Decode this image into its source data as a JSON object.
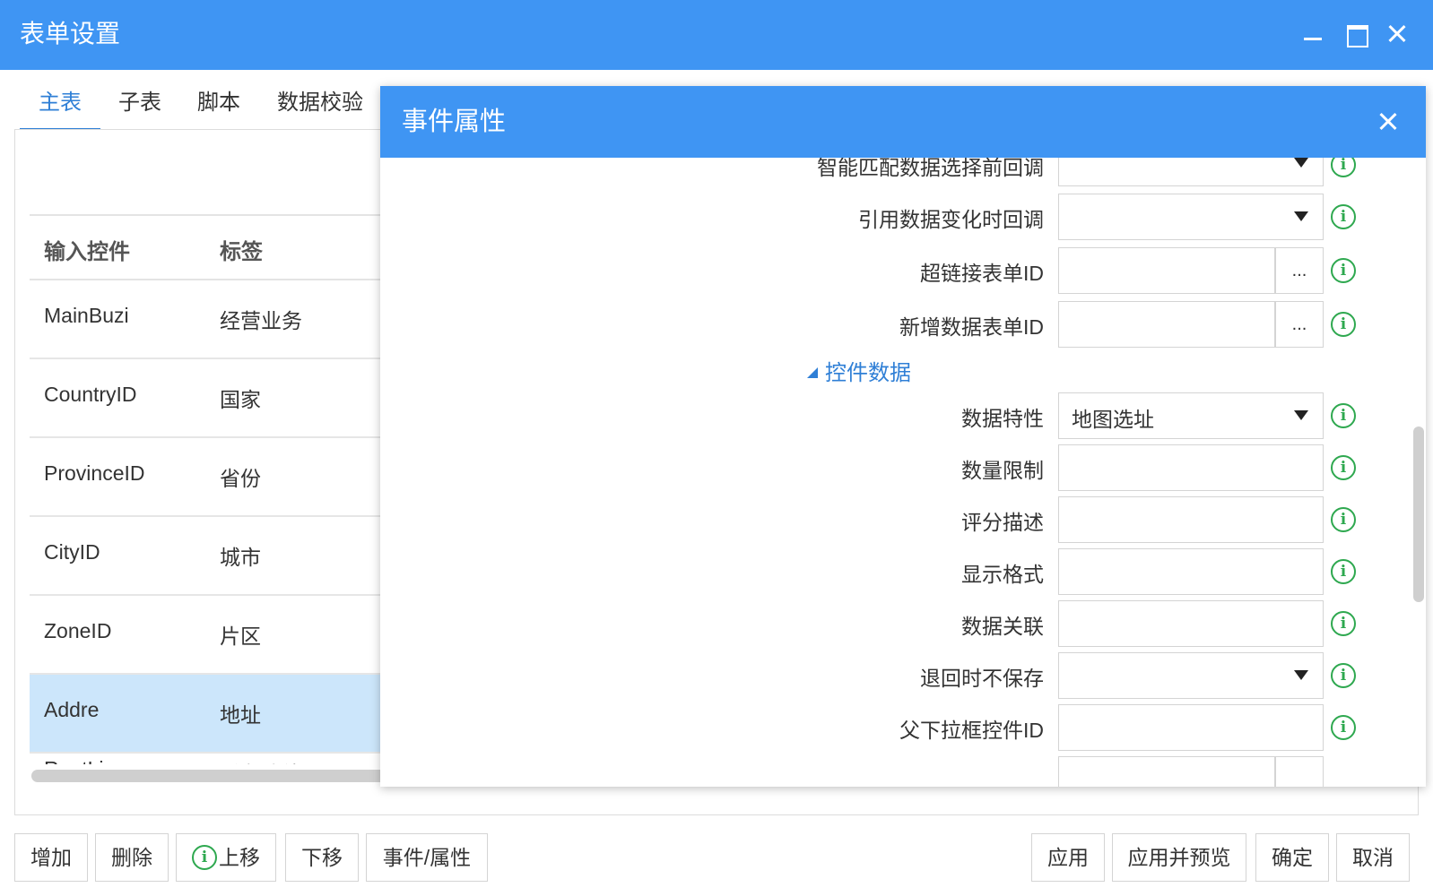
{
  "window": {
    "title": "表单设置"
  },
  "tabs": [
    {
      "label": "主表"
    },
    {
      "label": "子表"
    },
    {
      "label": "脚本"
    },
    {
      "label": "数据校验"
    }
  ],
  "grid": {
    "headers": [
      "输入控件",
      "标签"
    ],
    "rows": [
      {
        "control": "MainBuzi",
        "label": "经营业务"
      },
      {
        "control": "CountryID",
        "label": "国家"
      },
      {
        "control": "ProvinceID",
        "label": "省份"
      },
      {
        "control": "CityID",
        "label": "城市"
      },
      {
        "control": "ZoneID",
        "label": "片区"
      },
      {
        "control": "Addre",
        "label": "地址",
        "selected": true
      },
      {
        "control": "RoutLine",
        "label": "乘车路线"
      }
    ]
  },
  "buttons_left": [
    "增加",
    "删除",
    "上移",
    "下移",
    "事件/属性"
  ],
  "buttons_right": [
    "应用",
    "应用并预览",
    "确定",
    "取消"
  ],
  "dialog": {
    "title": "事件属性",
    "props_top": [
      {
        "label": "智能匹配数据选择前回调",
        "value": "",
        "type": "select"
      },
      {
        "label": "引用数据变化时回调",
        "value": "",
        "type": "select"
      },
      {
        "label": "超链接表单ID",
        "value": "",
        "type": "button",
        "button_label": "..."
      },
      {
        "label": "新增数据表单ID",
        "value": "",
        "type": "button",
        "button_label": "..."
      }
    ],
    "section": {
      "label": "控件数据"
    },
    "props_bottom": [
      {
        "label": "数据特性",
        "value": "地图选址",
        "type": "select"
      },
      {
        "label": "数量限制",
        "value": "",
        "type": "text"
      },
      {
        "label": "评分描述",
        "value": "",
        "type": "text"
      },
      {
        "label": "显示格式",
        "value": "",
        "type": "text"
      },
      {
        "label": "数据关联",
        "value": "",
        "type": "text"
      },
      {
        "label": "退回时不保存",
        "value": "",
        "type": "select"
      },
      {
        "label": "父下拉框控件ID",
        "value": "",
        "type": "text"
      }
    ]
  },
  "info_glyph": "i",
  "colors": {
    "header": "#3f95f3",
    "accent": "#2f7fd6",
    "info": "#2ea84f",
    "selected_row": "#cce6fb"
  }
}
